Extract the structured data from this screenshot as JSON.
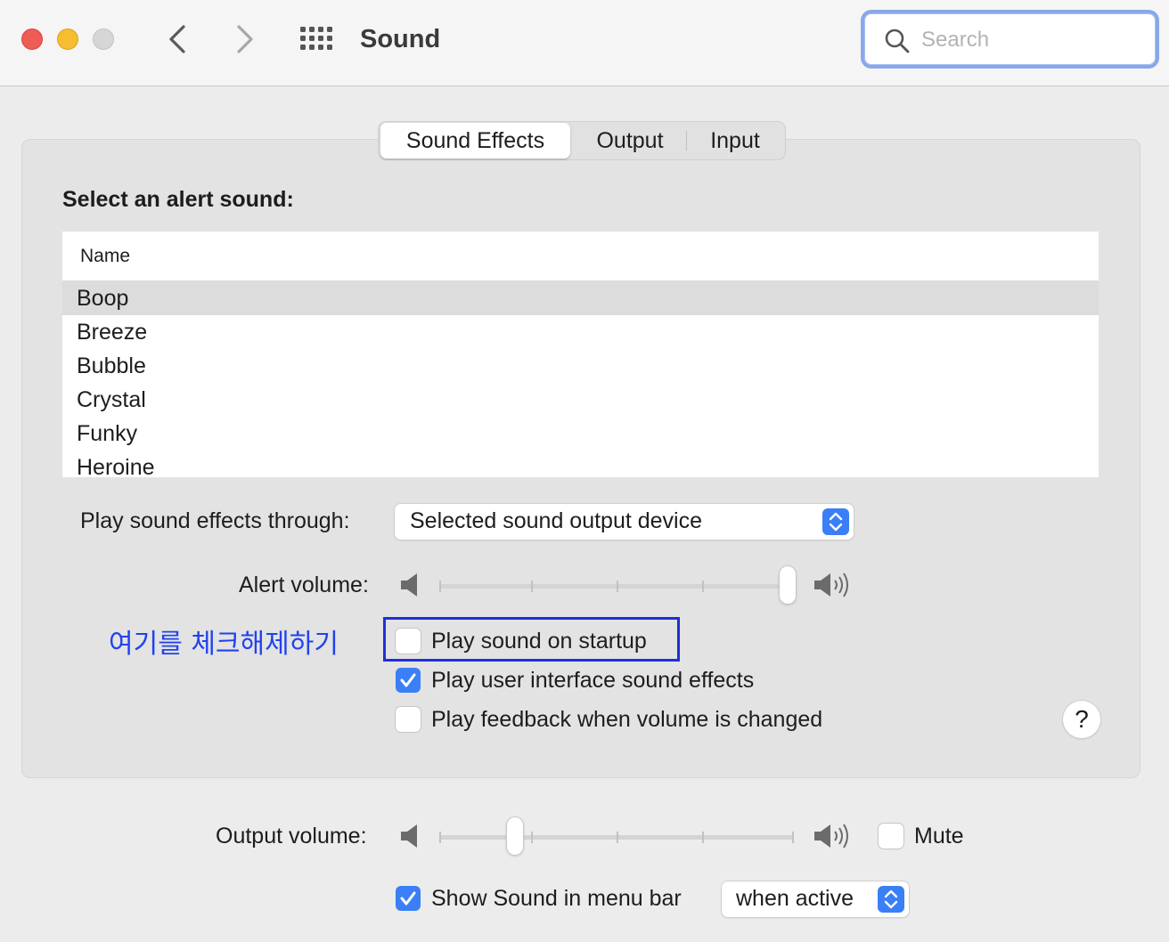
{
  "window": {
    "title": "Sound",
    "search_placeholder": "Search"
  },
  "tabs": [
    {
      "label": "Sound Effects",
      "active": true
    },
    {
      "label": "Output",
      "active": false
    },
    {
      "label": "Input",
      "active": false
    }
  ],
  "sound_effects": {
    "section_label": "Select an alert sound:",
    "list_header": "Name",
    "sounds": [
      {
        "name": "Boop",
        "selected": true
      },
      {
        "name": "Breeze",
        "selected": false
      },
      {
        "name": "Bubble",
        "selected": false
      },
      {
        "name": "Crystal",
        "selected": false
      },
      {
        "name": "Funky",
        "selected": false
      },
      {
        "name": "Heroine",
        "selected": false
      }
    ],
    "play_through_label": "Play sound effects through:",
    "play_through_value": "Selected sound output device",
    "alert_volume_label": "Alert volume:",
    "alert_volume_level": 1.0,
    "checkboxes": {
      "startup": {
        "label": "Play sound on startup",
        "checked": false
      },
      "ui_effects": {
        "label": "Play user interface sound effects",
        "checked": true
      },
      "feedback": {
        "label": "Play feedback when volume is changed",
        "checked": false
      }
    },
    "help_label": "?"
  },
  "annotation": {
    "text": "여기를 체크해제하기",
    "color": "#2142ee"
  },
  "footer": {
    "output_volume_label": "Output volume:",
    "output_volume_level": 0.2,
    "mute_label": "Mute",
    "mute_checked": false,
    "show_in_menubar_label": "Show Sound in menu bar",
    "show_in_menubar_checked": true,
    "menubar_mode": "when active"
  },
  "colors": {
    "accent": "#3a7ff5",
    "close": "#ee5c55",
    "minimize": "#f5bd2f",
    "zoom_disabled": "#d6d6d6"
  }
}
